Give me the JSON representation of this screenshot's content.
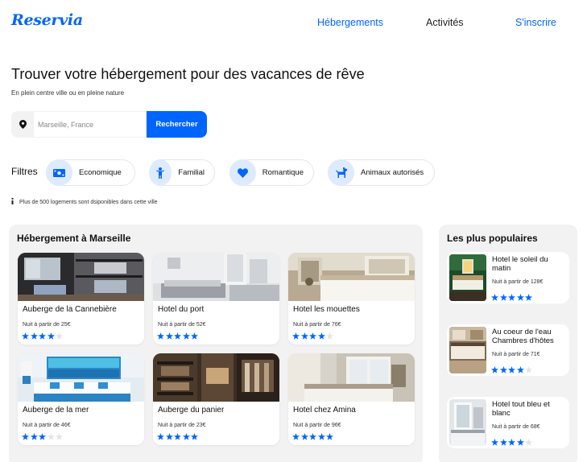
{
  "header": {
    "logo": "Reservia",
    "nav": [
      {
        "label": "Hébergements"
      },
      {
        "label": "Activités"
      },
      {
        "label": "S'inscrire"
      }
    ]
  },
  "hero": {
    "title": "Trouver votre hébergement pour des vacances de rêve",
    "subtitle": "En plein centre ville ou en pleine nature"
  },
  "search": {
    "placeholder": "Marseille, France",
    "button_label": "Rechercher",
    "pin_icon": "map-pin-icon"
  },
  "filters": {
    "label": "Filtres",
    "items": [
      {
        "label": "Economique",
        "icon": "money-icon"
      },
      {
        "label": "Familial",
        "icon": "child-icon"
      },
      {
        "label": "Romantique",
        "icon": "heart-icon"
      },
      {
        "label": "Animaux autorisés",
        "icon": "dog-icon"
      }
    ]
  },
  "info": {
    "text": "Plus de 500 logements sont dsiponibles dans cette ville"
  },
  "listings": {
    "title": "Hébergement à Marseille",
    "items": [
      {
        "name": "Auberge de la Cannebière",
        "price": "Nuit à partir de 25€",
        "rating": 4
      },
      {
        "name": "Hotel du port",
        "price": "Nuit à partir de 52€",
        "rating": 5
      },
      {
        "name": "Hotel les mouettes",
        "price": "Nuit à partir de 76€",
        "rating": 4
      },
      {
        "name": "Auberge de la mer",
        "price": "Nuit à partir de 46€",
        "rating": 3
      },
      {
        "name": "Auberge du panier",
        "price": "Nuit à partir de 23€",
        "rating": 5
      },
      {
        "name": "Hotel chez Amina",
        "price": "Nuit à partir de 96€",
        "rating": 5
      }
    ]
  },
  "popular": {
    "title": "Les plus populaires",
    "items": [
      {
        "name": "Hotel le soleil du matin",
        "price": "Nuit à partir de 128€",
        "rating": 5
      },
      {
        "name": "Au coeur de l'eau Chambres d'hôtes",
        "price": "Nuit à partir de 71€",
        "rating": 4
      },
      {
        "name": "Hotel tout bleu et blanc",
        "price": "Nuit à partir de 68€",
        "rating": 4
      }
    ]
  },
  "colors": {
    "primary": "#0065FC",
    "filter_bg": "#DEEBFF",
    "panel_bg": "#F2F2F2",
    "star_on": "#0065FC",
    "star_off": "#E3E3E3"
  }
}
